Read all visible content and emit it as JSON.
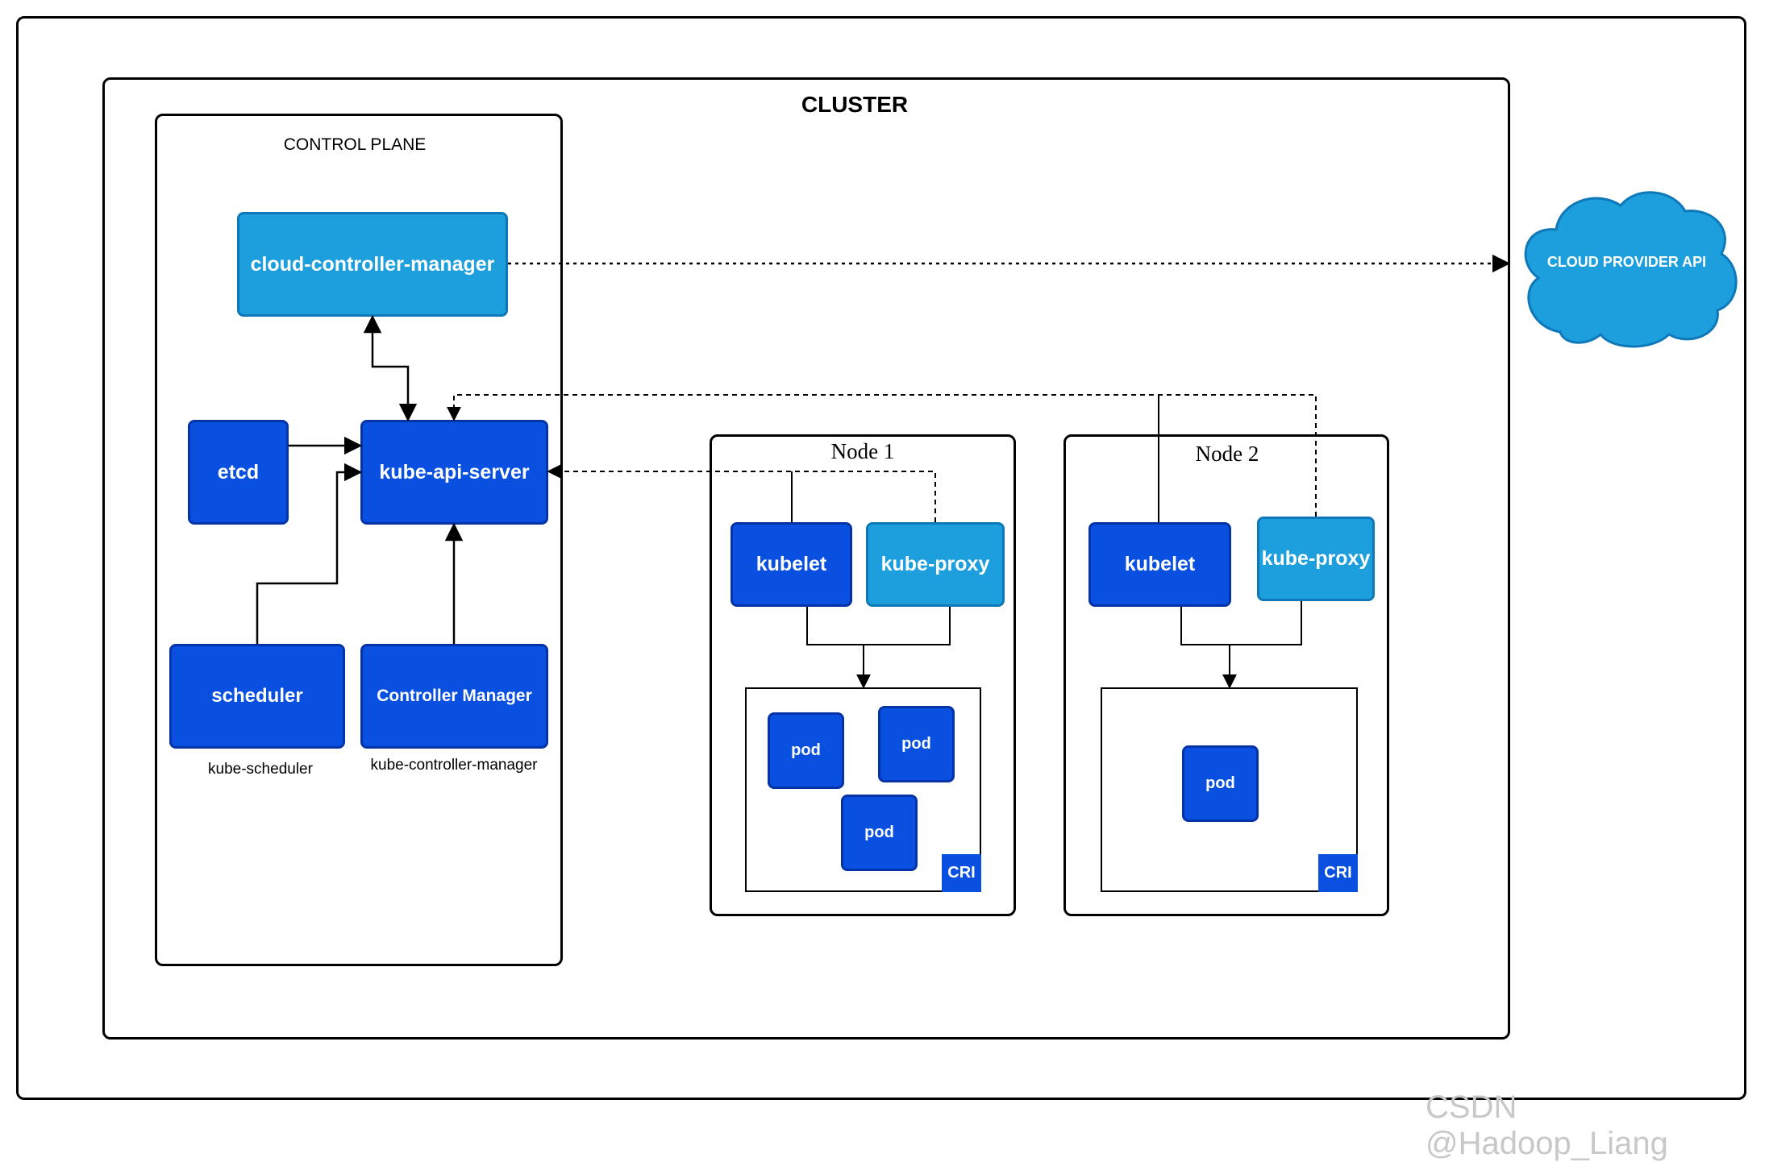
{
  "cluster": {
    "title": "CLUSTER"
  },
  "control_plane": {
    "title": "CONTROL PLANE",
    "cloud_controller_manager": "cloud-controller-manager",
    "etcd": "etcd",
    "kube_api_server": "kube-api-server",
    "scheduler": "scheduler",
    "scheduler_caption": "kube-scheduler",
    "controller_manager": "Controller Manager",
    "controller_manager_caption": "kube-controller-manager"
  },
  "node1": {
    "title": "Node 1",
    "kubelet": "kubelet",
    "kube_proxy": "kube-proxy",
    "pods": [
      "pod",
      "pod",
      "pod"
    ],
    "cri": "CRI"
  },
  "node2": {
    "title": "Node 2",
    "kubelet": "kubelet",
    "kube_proxy": "kube-proxy",
    "pods": [
      "pod"
    ],
    "cri": "CRI"
  },
  "cloud_provider": {
    "label": "CLOUD PROVIDER API"
  },
  "watermark": "CSDN @Hadoop_Liang",
  "colors": {
    "dark_blue": "#0a50e0",
    "light_blue": "#1d9fdd",
    "cloud": "#1d9fdd"
  }
}
